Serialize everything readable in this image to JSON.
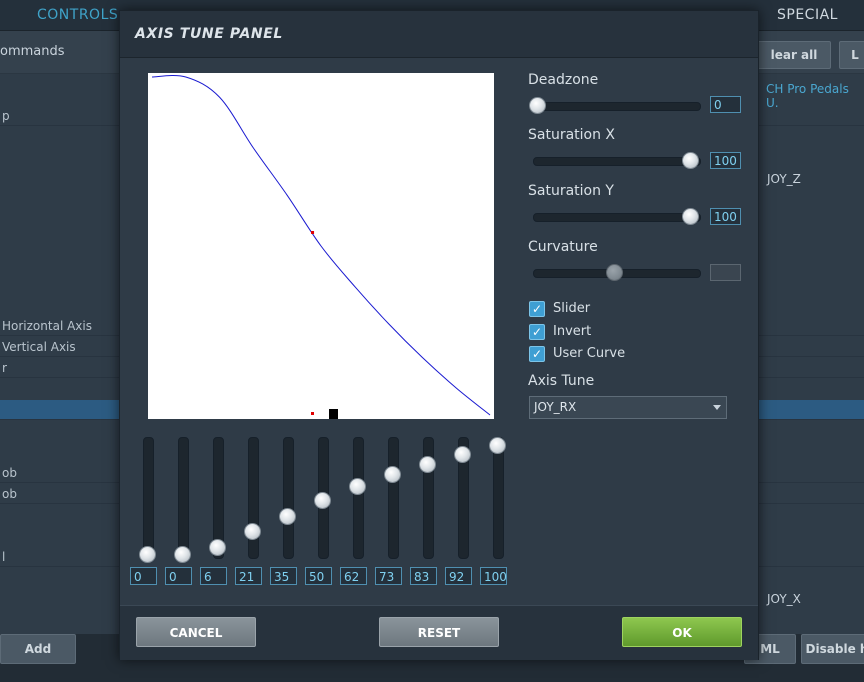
{
  "background": {
    "tabs": {
      "controls": "CONTROLS",
      "special": "SPECIAL"
    },
    "commands_label": "ommands",
    "clear_all": "lear all",
    "right_btn": "L",
    "row_texts": [
      "p",
      "Horizontal Axis",
      "Vertical Axis",
      "r",
      "ob",
      "ob",
      "l"
    ],
    "pedals_header": "CH Pro Pedals U.",
    "joy_z": "JOY_Z",
    "joy_x": "JOY_X",
    "bottom_add": "Add",
    "bottom_ml": "ML",
    "bottom_disable": "Disable h"
  },
  "modal": {
    "title": "AXIS TUNE PANEL",
    "deadzone": {
      "label": "Deadzone",
      "value": "0",
      "level": 0
    },
    "saturation_x": {
      "label": "Saturation X",
      "value": "100",
      "level": 100
    },
    "saturation_y": {
      "label": "Saturation Y",
      "value": "100",
      "level": 100
    },
    "curvature": {
      "label": "Curvature",
      "value": "",
      "level": 50
    },
    "checkboxes": [
      {
        "label": "Slider",
        "checked": true
      },
      {
        "label": "Invert",
        "checked": true
      },
      {
        "label": "User Curve",
        "checked": true
      }
    ],
    "axis_tune": {
      "label": "Axis Tune",
      "selected": "JOY_RX"
    },
    "curve_points": [
      "0",
      "0",
      "6",
      "21",
      "35",
      "50",
      "62",
      "73",
      "83",
      "92",
      "100"
    ],
    "buttons": {
      "cancel": "CANCEL",
      "reset": "RESET",
      "ok": "OK"
    }
  },
  "chart_data": {
    "type": "line",
    "x": [
      0,
      10,
      20,
      30,
      40,
      50,
      60,
      70,
      80,
      90,
      100
    ],
    "values": [
      0,
      0,
      6,
      21,
      35,
      50,
      62,
      73,
      83,
      92,
      100
    ],
    "inverted": true,
    "xlim": [
      0,
      100
    ],
    "ylim": [
      0,
      100
    ]
  }
}
